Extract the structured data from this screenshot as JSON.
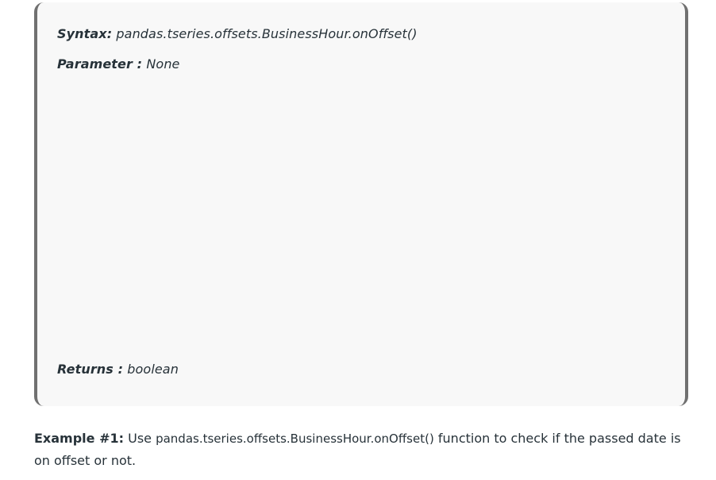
{
  "syntax": {
    "label": "Syntax:",
    "value": " pandas.tseries.offsets.BusinessHour.onOffset()"
  },
  "parameter": {
    "label": "Parameter :",
    "value": " None"
  },
  "returns": {
    "label": "Returns :",
    "value": " boolean"
  },
  "example": {
    "label": "Example #1:",
    "text_before": " Use ",
    "code": "pandas.tseries.offsets.BusinessHour.onOffset()",
    "text_after": " function to check if the passed date is on offset or not."
  }
}
